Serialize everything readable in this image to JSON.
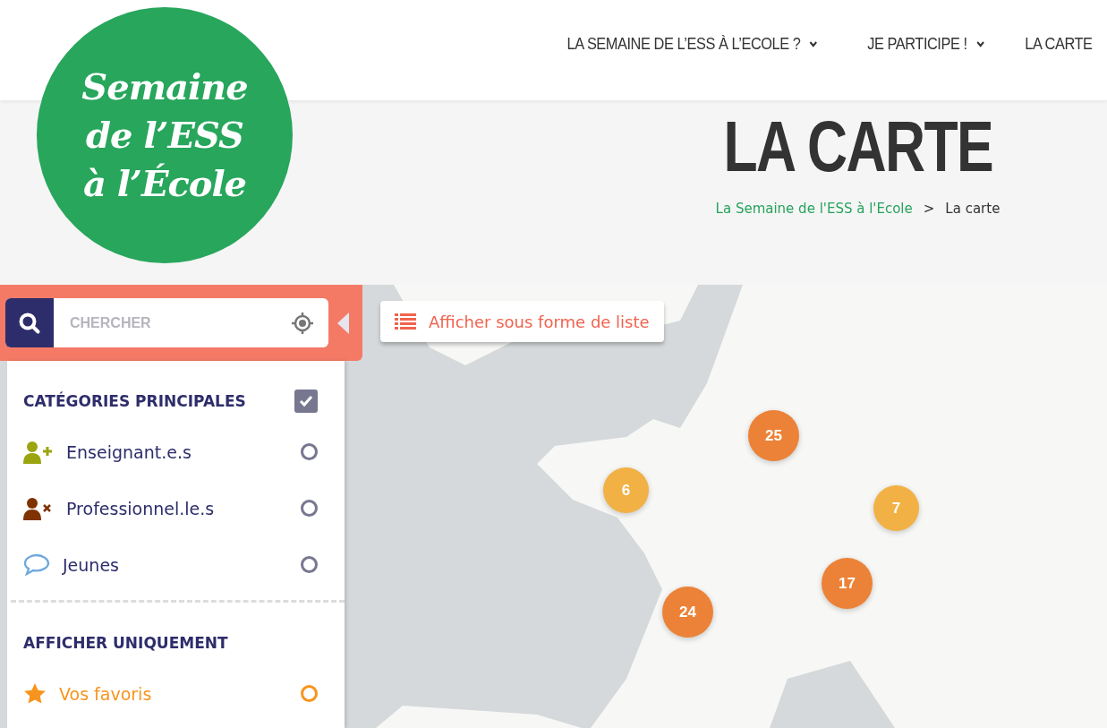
{
  "logo": {
    "lines": [
      "Semaine",
      "de l’ESS",
      "à l’École"
    ]
  },
  "nav": [
    {
      "label": "LA SEMAINE DE L’ESS À L’ECOLE ?",
      "dropdown": true
    },
    {
      "label": "JE PARTICIPE !",
      "dropdown": true
    },
    {
      "label": "LA CARTE",
      "dropdown": false
    }
  ],
  "hero": {
    "title": "LA CARTE",
    "breadcrumb": [
      {
        "label": "La Semaine de l'ESS à l'Ecole",
        "link": true
      },
      {
        "label": "La carte",
        "link": false
      }
    ],
    "separator": ">"
  },
  "search": {
    "placeholder": "CHERCHER"
  },
  "list_button": {
    "label": "Afficher sous forme de liste"
  },
  "filters": {
    "main_title": "CATÉGORIES PRINCIPALES",
    "main_checked": true,
    "categories": [
      {
        "kind": "teacher",
        "label": "Enseignant.e.s",
        "selected": false,
        "color": "#9aa50f"
      },
      {
        "kind": "professional",
        "label": "Professionnel.le.s",
        "selected": false,
        "color": "#7f3300"
      },
      {
        "kind": "youth",
        "label": "Jeunes",
        "selected": false,
        "color": "#6fa8dc"
      }
    ],
    "only_title": "AFFICHER UNIQUEMENT",
    "only": [
      {
        "kind": "favorites",
        "label": "Vos favoris",
        "selected": false,
        "color": "#f7941d"
      }
    ]
  },
  "clusters": [
    {
      "count": "25",
      "color": "#ec8237",
      "big": true
    },
    {
      "count": "6",
      "color": "#f2b144",
      "big": false
    },
    {
      "count": "7",
      "color": "#f2b144",
      "big": false
    },
    {
      "count": "17",
      "color": "#ec8237",
      "big": true
    },
    {
      "count": "24",
      "color": "#ec8237",
      "big": true
    }
  ]
}
